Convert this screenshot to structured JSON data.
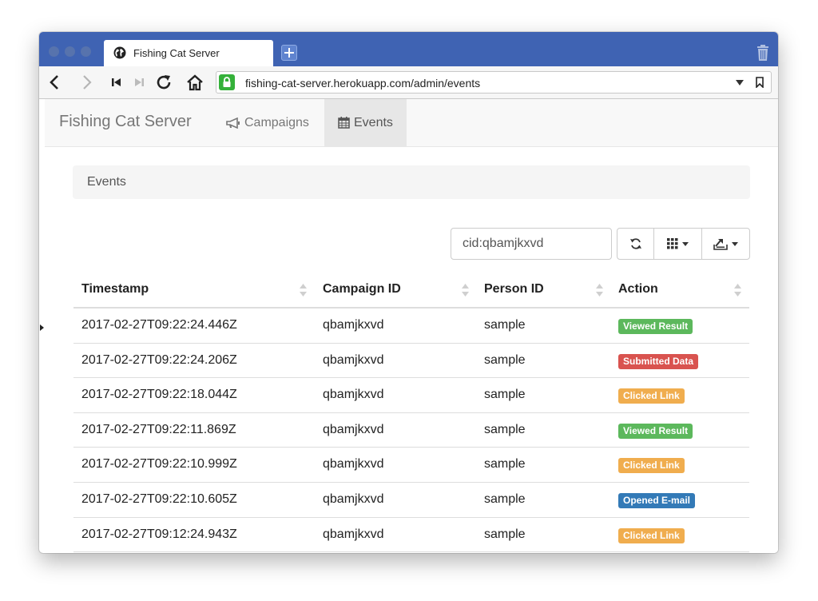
{
  "browser": {
    "tab_title": "Fishing Cat Server",
    "url": "fishing-cat-server.herokuapp.com/admin/events"
  },
  "app": {
    "brand": "Fishing Cat Server",
    "nav": [
      {
        "label": "Campaigns",
        "icon": "bullhorn-icon"
      },
      {
        "label": "Events",
        "icon": "calendar-icon",
        "active": true
      }
    ]
  },
  "panel_title": "Events",
  "search": {
    "value": "cid:qbamjkxvd"
  },
  "table": {
    "columns": [
      "Timestamp",
      "Campaign ID",
      "Person ID",
      "Action"
    ],
    "rows": [
      {
        "timestamp": "2017-02-27T09:22:24.446Z",
        "campaign_id": "qbamjkxvd",
        "person_id": "sample",
        "action": "Viewed Result",
        "color": "#5cb85c"
      },
      {
        "timestamp": "2017-02-27T09:22:24.206Z",
        "campaign_id": "qbamjkxvd",
        "person_id": "sample",
        "action": "Submitted Data",
        "color": "#d9534f"
      },
      {
        "timestamp": "2017-02-27T09:22:18.044Z",
        "campaign_id": "qbamjkxvd",
        "person_id": "sample",
        "action": "Clicked Link",
        "color": "#f0ad4e"
      },
      {
        "timestamp": "2017-02-27T09:22:11.869Z",
        "campaign_id": "qbamjkxvd",
        "person_id": "sample",
        "action": "Viewed Result",
        "color": "#5cb85c"
      },
      {
        "timestamp": "2017-02-27T09:22:10.999Z",
        "campaign_id": "qbamjkxvd",
        "person_id": "sample",
        "action": "Clicked Link",
        "color": "#f0ad4e"
      },
      {
        "timestamp": "2017-02-27T09:22:10.605Z",
        "campaign_id": "qbamjkxvd",
        "person_id": "sample",
        "action": "Opened E-mail",
        "color": "#337ab7"
      },
      {
        "timestamp": "2017-02-27T09:12:24.943Z",
        "campaign_id": "qbamjkxvd",
        "person_id": "sample",
        "action": "Clicked Link",
        "color": "#f0ad4e"
      }
    ]
  },
  "colors": {
    "tabbar": "#3f63b3",
    "secure_lock": "#35b13a"
  }
}
